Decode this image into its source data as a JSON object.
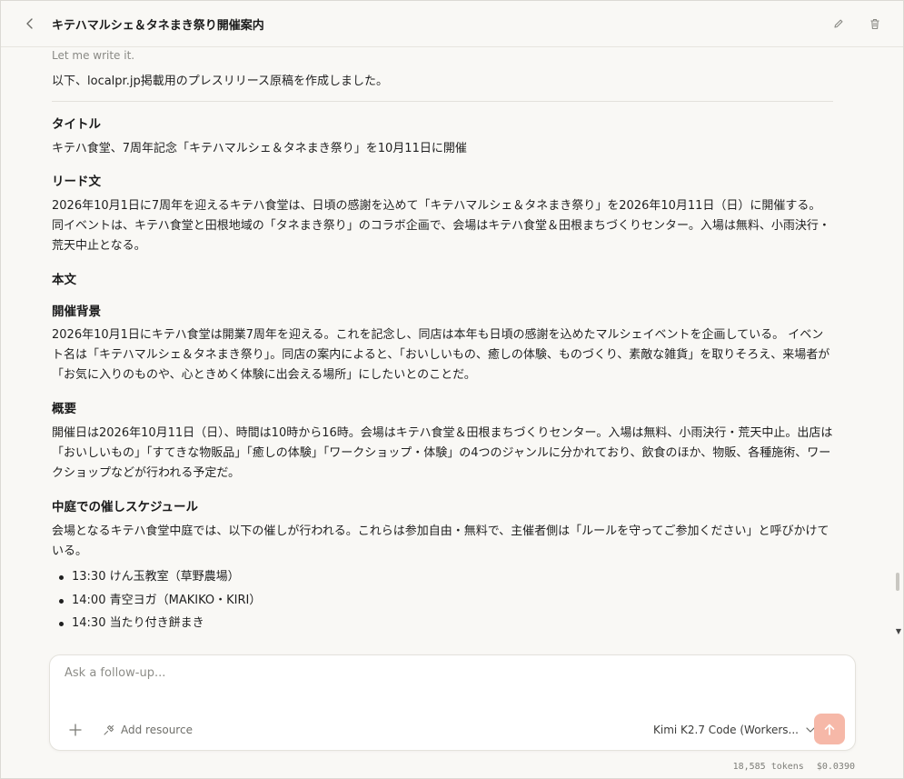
{
  "header": {
    "title": "キテハマルシェ＆タネまき祭り開催案内"
  },
  "message": {
    "thinking_snippet": "Let me write it.",
    "intro": "以下、localpr.jp掲載用のプレスリリース原稿を作成しました。",
    "sections": {
      "title_heading": "タイトル",
      "title_text": "キテハ食堂、7周年記念「キテハマルシェ＆タネまき祭り」を10月11日に開催",
      "lead_heading": "リード文",
      "lead_text": "2026年10月1日に7周年を迎えるキテハ食堂は、日頃の感謝を込めて「キテハマルシェ＆タネまき祭り」を2026年10月11日（日）に開催する。 同イベントは、キテハ食堂と田根地域の「タネまき祭り」のコラボ企画で、会場はキテハ食堂＆田根まちづくりセンター。入場は無料、小雨決行・荒天中止となる。",
      "body_heading": "本文",
      "background_heading": "開催背景",
      "background_text": "2026年10月1日にキテハ食堂は開業7周年を迎える。これを記念し、同店は本年も日頃の感謝を込めたマルシェイベントを企画している。 イベント名は「キテハマルシェ＆タネまき祭り」。同店の案内によると、「おいしいもの、癒しの体験、ものづくり、素敵な雑貨」を取りそろえ、来場者が「お気に入りのものや、心ときめく体験に出会える場所」にしたいとのことだ。",
      "overview_heading": "概要",
      "overview_text": "開催日は2026年10月11日（日）、時間は10時から16時。会場はキテハ食堂＆田根まちづくりセンター。入場は無料、小雨決行・荒天中止。出店は「おいしいもの」「すてきな物販品」「癒しの体験」「ワークショップ・体験」の4つのジャンルに分かれており、飲食のほか、物販、各種施術、ワークショップなどが行われる予定だ。",
      "schedule_heading": "中庭での催しスケジュール",
      "schedule_text": "会場となるキテハ食堂中庭では、以下の催しが行われる。これらは参加自由・無料で、主催者側は「ルールを守ってご参加ください」と呼びかけている。",
      "schedule_items": [
        "13:30 けん玉教室（草野農場）",
        "14:00 青空ヨガ（MAKIKO・KIRI）",
        "14:30 当たり付き餅まき"
      ]
    }
  },
  "composer": {
    "placeholder": "Ask a follow-up...",
    "add_resource_label": "Add resource",
    "model_label": "Kimi K2.7 Code (Workers..."
  },
  "footer": {
    "tokens": "18,585 tokens",
    "cost": "$0.0390"
  },
  "colors": {
    "accent_send": "#f6b8a8",
    "background": "#f9f8f5"
  }
}
